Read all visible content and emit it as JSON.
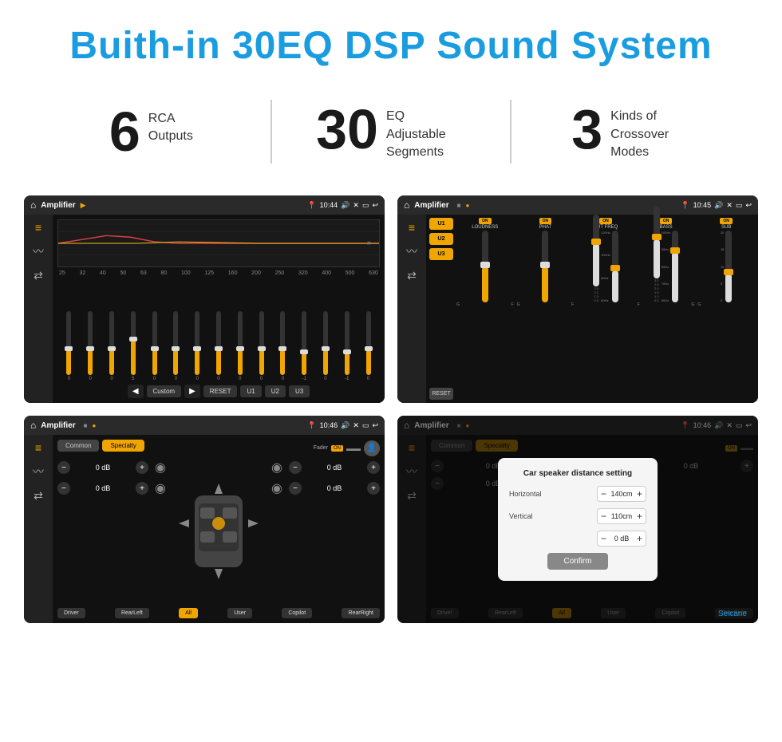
{
  "header": {
    "title": "Buith-in 30EQ DSP Sound System"
  },
  "stats": [
    {
      "number": "6",
      "text": "RCA\nOutputs"
    },
    {
      "number": "30",
      "text": "EQ Adjustable\nSegments"
    },
    {
      "number": "3",
      "text": "Kinds of\nCrossover Modes"
    }
  ],
  "screens": {
    "eq_screen": {
      "title": "Amplifier",
      "time": "10:44",
      "freq_labels": [
        "25",
        "32",
        "40",
        "50",
        "63",
        "80",
        "100",
        "125",
        "160",
        "200",
        "250",
        "320",
        "400",
        "500",
        "630"
      ],
      "values": [
        "0",
        "0",
        "0",
        "5",
        "0",
        "0",
        "0",
        "0",
        "0",
        "0",
        "0",
        "-1",
        "0",
        "-1"
      ],
      "bottom_buttons": [
        "Custom",
        "RESET",
        "U1",
        "U2",
        "U3"
      ]
    },
    "amp_screen": {
      "title": "Amplifier",
      "time": "10:45",
      "u_buttons": [
        "U1",
        "U2",
        "U3"
      ],
      "controls": [
        "LOUDNESS",
        "PHAT",
        "CUT FREQ",
        "BASS",
        "SUB"
      ],
      "reset_label": "RESET"
    },
    "fader_screen": {
      "title": "Amplifier",
      "time": "10:46",
      "tabs": [
        "Common",
        "Specialty"
      ],
      "fader_label": "Fader",
      "on_label": "ON",
      "db_values": [
        "0 dB",
        "0 dB",
        "0 dB",
        "0 dB"
      ],
      "bottom_buttons": [
        "Driver",
        "RearLeft",
        "All",
        "User",
        "Copilot",
        "RearRight"
      ]
    },
    "dialog_screen": {
      "title": "Amplifier",
      "time": "10:46",
      "tabs": [
        "Common",
        "Specialty"
      ],
      "dialog": {
        "title": "Car speaker distance setting",
        "horizontal_label": "Horizontal",
        "horizontal_value": "140cm",
        "vertical_label": "Vertical",
        "vertical_value": "110cm",
        "confirm_label": "Confirm",
        "db_value": "0 dB"
      },
      "bottom_buttons": [
        "Driver",
        "RearLeft",
        "All",
        "User",
        "Copilot",
        "RearRight"
      ]
    }
  },
  "watermark": "Seicane"
}
